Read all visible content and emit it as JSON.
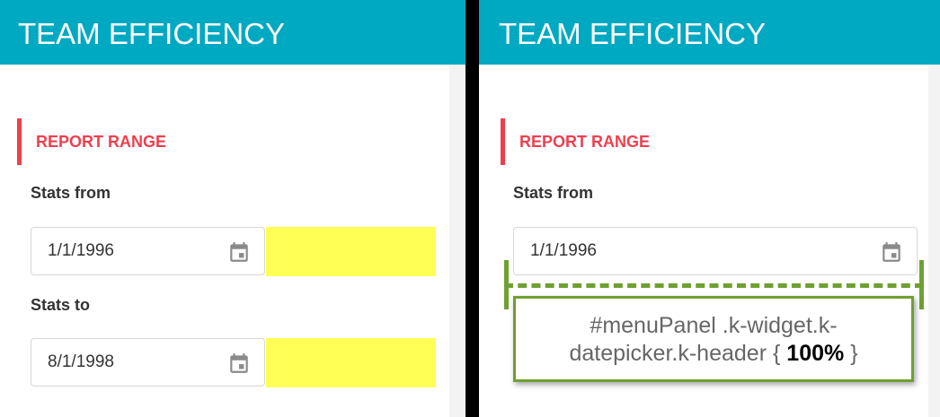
{
  "left_panel": {
    "header": {
      "title": "TEAM EFFICIENCY"
    },
    "section": {
      "title": "REPORT RANGE"
    },
    "stats_from": {
      "label": "Stats from",
      "value": "1/1/1996"
    },
    "stats_to": {
      "label": "Stats to",
      "value": "8/1/1998"
    }
  },
  "right_panel": {
    "header": {
      "title": "TEAM EFFICIENCY"
    },
    "section": {
      "title": "REPORT RANGE"
    },
    "stats_from": {
      "label": "Stats from",
      "value": "1/1/1996"
    },
    "annotation": {
      "selector_line1": "#menuPanel .k-widget.k-",
      "selector_line2": "datepicker.k-header",
      "open_brace": "{",
      "value": "100%",
      "close_brace": "}"
    }
  },
  "colors": {
    "header_bg": "#00a9c2",
    "accent_red": "#ef3f4f",
    "highlight_yellow": "#ffff55",
    "annotation_green": "#6fa032"
  },
  "icons": [
    "calendar-icon"
  ]
}
